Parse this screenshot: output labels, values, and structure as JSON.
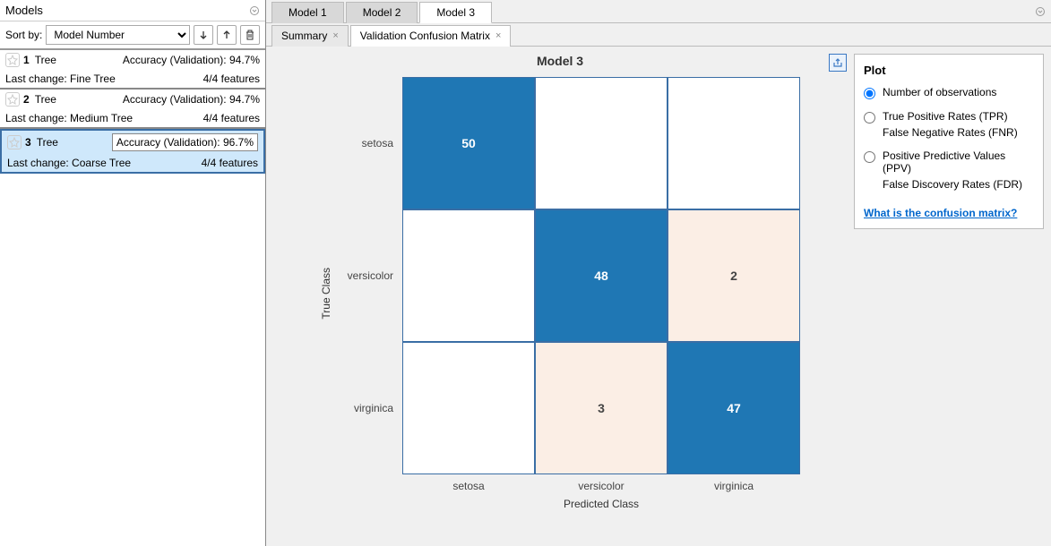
{
  "left_panel": {
    "title": "Models",
    "sort_label": "Sort by:",
    "sort_value": "Model Number",
    "items": [
      {
        "num": "1",
        "type": "Tree",
        "accuracy": "Accuracy (Validation): 94.7%",
        "lastchange": "Last change: Fine Tree",
        "features": "4/4 features",
        "selected": false
      },
      {
        "num": "2",
        "type": "Tree",
        "accuracy": "Accuracy (Validation): 94.7%",
        "lastchange": "Last change: Medium Tree",
        "features": "4/4 features",
        "selected": false
      },
      {
        "num": "3",
        "type": "Tree",
        "accuracy": "Accuracy (Validation): 96.7%",
        "lastchange": "Last change: Coarse Tree",
        "features": "4/4 features",
        "selected": true
      }
    ]
  },
  "top_tabs": [
    "Model 1",
    "Model 2",
    "Model 3"
  ],
  "top_tab_active": 2,
  "sub_tabs": [
    "Summary",
    "Validation Confusion Matrix"
  ],
  "sub_tab_active": 1,
  "chart_data": {
    "type": "heatmap",
    "title": "Model 3",
    "xlabel": "Predicted Class",
    "ylabel": "True Class",
    "row_labels": [
      "setosa",
      "versicolor",
      "virginica"
    ],
    "col_labels": [
      "setosa",
      "versicolor",
      "virginica"
    ],
    "values": [
      [
        50,
        0,
        0
      ],
      [
        0,
        48,
        2
      ],
      [
        0,
        3,
        47
      ]
    ]
  },
  "plot_panel": {
    "title": "Plot",
    "options": [
      {
        "lines": [
          "Number of observations"
        ],
        "checked": true
      },
      {
        "lines": [
          "True Positive Rates (TPR)",
          "False Negative Rates (FNR)"
        ],
        "checked": false
      },
      {
        "lines": [
          "Positive Predictive Values (PPV)",
          "False Discovery Rates (FDR)"
        ],
        "checked": false
      }
    ],
    "help_link": "What is the confusion matrix?"
  }
}
